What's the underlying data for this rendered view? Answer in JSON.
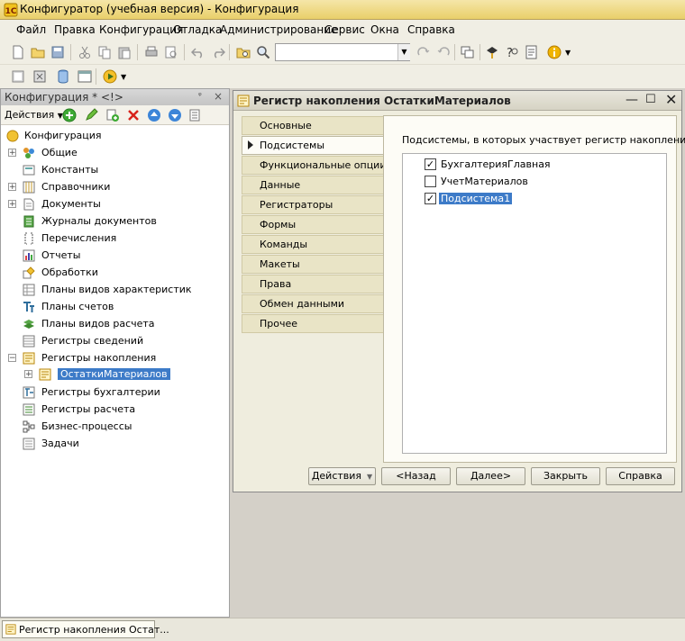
{
  "window": {
    "title": "Конфигуратор (учебная версия) - Конфигурация"
  },
  "menu": [
    "Файл",
    "Правка",
    "Конфигурация",
    "Отладка",
    "Администрирование",
    "Сервис",
    "Окна",
    "Справка"
  ],
  "toolbar": {
    "icons": [
      "new-document-icon",
      "open-folder-icon",
      "save-icon",
      "cut-icon",
      "copy-icon",
      "paste-icon",
      "print-icon",
      "print-preview-icon",
      "undo-icon",
      "redo-icon",
      "find-in-folder-icon",
      "find-icon",
      "search-next-icon",
      "search-prev-icon",
      "windows-icon",
      "syntax-helper-icon",
      "help-search-icon",
      "help-contents-icon",
      "info-icon"
    ],
    "search_value": ""
  },
  "toolbar2": {
    "icons": [
      "config-open-icon",
      "config-compare-icon",
      "database-icon",
      "window-list-icon",
      "run-debug-icon"
    ]
  },
  "tree_panel": {
    "title": "Конфигурация * <!>",
    "actions_label": "Действия",
    "items": [
      {
        "label": "Конфигурация",
        "icon": "configuration-icon",
        "level": 0,
        "expander": ""
      },
      {
        "label": "Общие",
        "icon": "common-icon",
        "level": 1,
        "expander": "+"
      },
      {
        "label": "Константы",
        "icon": "constants-icon",
        "level": 1,
        "expander": ""
      },
      {
        "label": "Справочники",
        "icon": "catalogs-icon",
        "level": 1,
        "expander": "+"
      },
      {
        "label": "Документы",
        "icon": "documents-icon",
        "level": 1,
        "expander": "+"
      },
      {
        "label": "Журналы документов",
        "icon": "journals-icon",
        "level": 1,
        "expander": ""
      },
      {
        "label": "Перечисления",
        "icon": "enums-icon",
        "level": 1,
        "expander": ""
      },
      {
        "label": "Отчеты",
        "icon": "reports-icon",
        "level": 1,
        "expander": ""
      },
      {
        "label": "Обработки",
        "icon": "processors-icon",
        "level": 1,
        "expander": ""
      },
      {
        "label": "Планы видов характеристик",
        "icon": "char-plans-icon",
        "level": 1,
        "expander": ""
      },
      {
        "label": "Планы счетов",
        "icon": "accounts-plans-icon",
        "level": 1,
        "expander": ""
      },
      {
        "label": "Планы видов расчета",
        "icon": "calc-plans-icon",
        "level": 1,
        "expander": ""
      },
      {
        "label": "Регистры сведений",
        "icon": "info-registers-icon",
        "level": 1,
        "expander": ""
      },
      {
        "label": "Регистры накопления",
        "icon": "accum-registers-icon",
        "level": 1,
        "expander": "−"
      },
      {
        "label": "ОстаткиМатериалов",
        "icon": "accum-register-item-icon",
        "level": 2,
        "expander": "+",
        "selected": true
      },
      {
        "label": "Регистры бухгалтерии",
        "icon": "accounting-registers-icon",
        "level": 1,
        "expander": ""
      },
      {
        "label": "Регистры расчета",
        "icon": "calc-registers-icon",
        "level": 1,
        "expander": ""
      },
      {
        "label": "Бизнес-процессы",
        "icon": "business-processes-icon",
        "level": 1,
        "expander": ""
      },
      {
        "label": "Задачи",
        "icon": "tasks-icon",
        "level": 1,
        "expander": ""
      }
    ]
  },
  "dialog": {
    "title": "Регистр накопления ОстаткиМатериалов",
    "tabs": [
      "Основные",
      "Подсистемы",
      "Функциональные опции",
      "Данные",
      "Регистраторы",
      "Формы",
      "Команды",
      "Макеты",
      "Права",
      "Обмен данными",
      "Прочее"
    ],
    "active_tab": 1,
    "caption": "Подсистемы, в которых участвует регистр накопления:",
    "subsystems": [
      {
        "label": "БухгалтерияГлавная",
        "checked": true,
        "selected": false
      },
      {
        "label": "УчетМатериалов",
        "checked": false,
        "selected": false
      },
      {
        "label": "Подсистема1",
        "checked": true,
        "selected": true
      }
    ],
    "buttons": {
      "actions": "Действия",
      "back": "<Назад",
      "next": "Далее>",
      "close": "Закрыть",
      "help": "Справка"
    }
  },
  "taskbar": {
    "item": "Регистр накопления Остат..."
  }
}
